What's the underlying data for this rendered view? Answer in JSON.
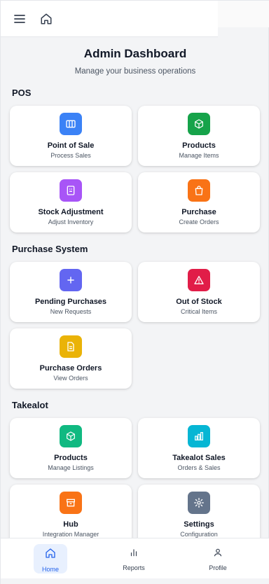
{
  "header": {
    "title": "Admin Dashboard",
    "subtitle": "Manage your business operations"
  },
  "sections": [
    {
      "title": "POS"
    },
    {
      "title": "Purchase System"
    },
    {
      "title": "Takealot"
    }
  ],
  "cards": [
    {
      "label": "Point of Sale",
      "sub": "Process Sales",
      "icon": "pos-icon",
      "color": "#3b82f6"
    },
    {
      "label": "Products",
      "sub": "Manage Items",
      "icon": "box-icon",
      "color": "#16a34a"
    },
    {
      "label": "Stock Adjustment",
      "sub": "Adjust Inventory",
      "icon": "inventory-icon",
      "color": "#a855f7"
    },
    {
      "label": "Purchase",
      "sub": "Create Orders",
      "icon": "shopping-bag-icon",
      "color": "#f97316"
    },
    {
      "label": "Pending Purchases",
      "sub": "New Requests",
      "icon": "plus-icon",
      "color": "#6366f1"
    },
    {
      "label": "Out of Stock",
      "sub": "Critical Items",
      "icon": "warning-icon",
      "color": "#e11d48"
    },
    {
      "label": "Purchase Orders",
      "sub": "View Orders",
      "icon": "document-icon",
      "color": "#eab308"
    },
    {
      "label": "Products",
      "sub": "Manage Listings",
      "icon": "box-icon",
      "color": "#10b981"
    },
    {
      "label": "Takealot Sales",
      "sub": "Orders & Sales",
      "icon": "bar-chart-icon",
      "color": "#06b6d4"
    },
    {
      "label": "Hub",
      "sub": "Integration Manager",
      "icon": "archive-icon",
      "color": "#f97316"
    },
    {
      "label": "Settings",
      "sub": "Configuration",
      "icon": "gear-icon",
      "color": "#64748b"
    }
  ],
  "nav": [
    {
      "label": "Home",
      "icon": "home-icon",
      "active": true
    },
    {
      "label": "Reports",
      "icon": "bar-chart-icon"
    },
    {
      "label": "Profile",
      "icon": "user-icon"
    }
  ],
  "colors": {
    "accent": "#2563eb",
    "active_bg": "#e8f0fe"
  }
}
